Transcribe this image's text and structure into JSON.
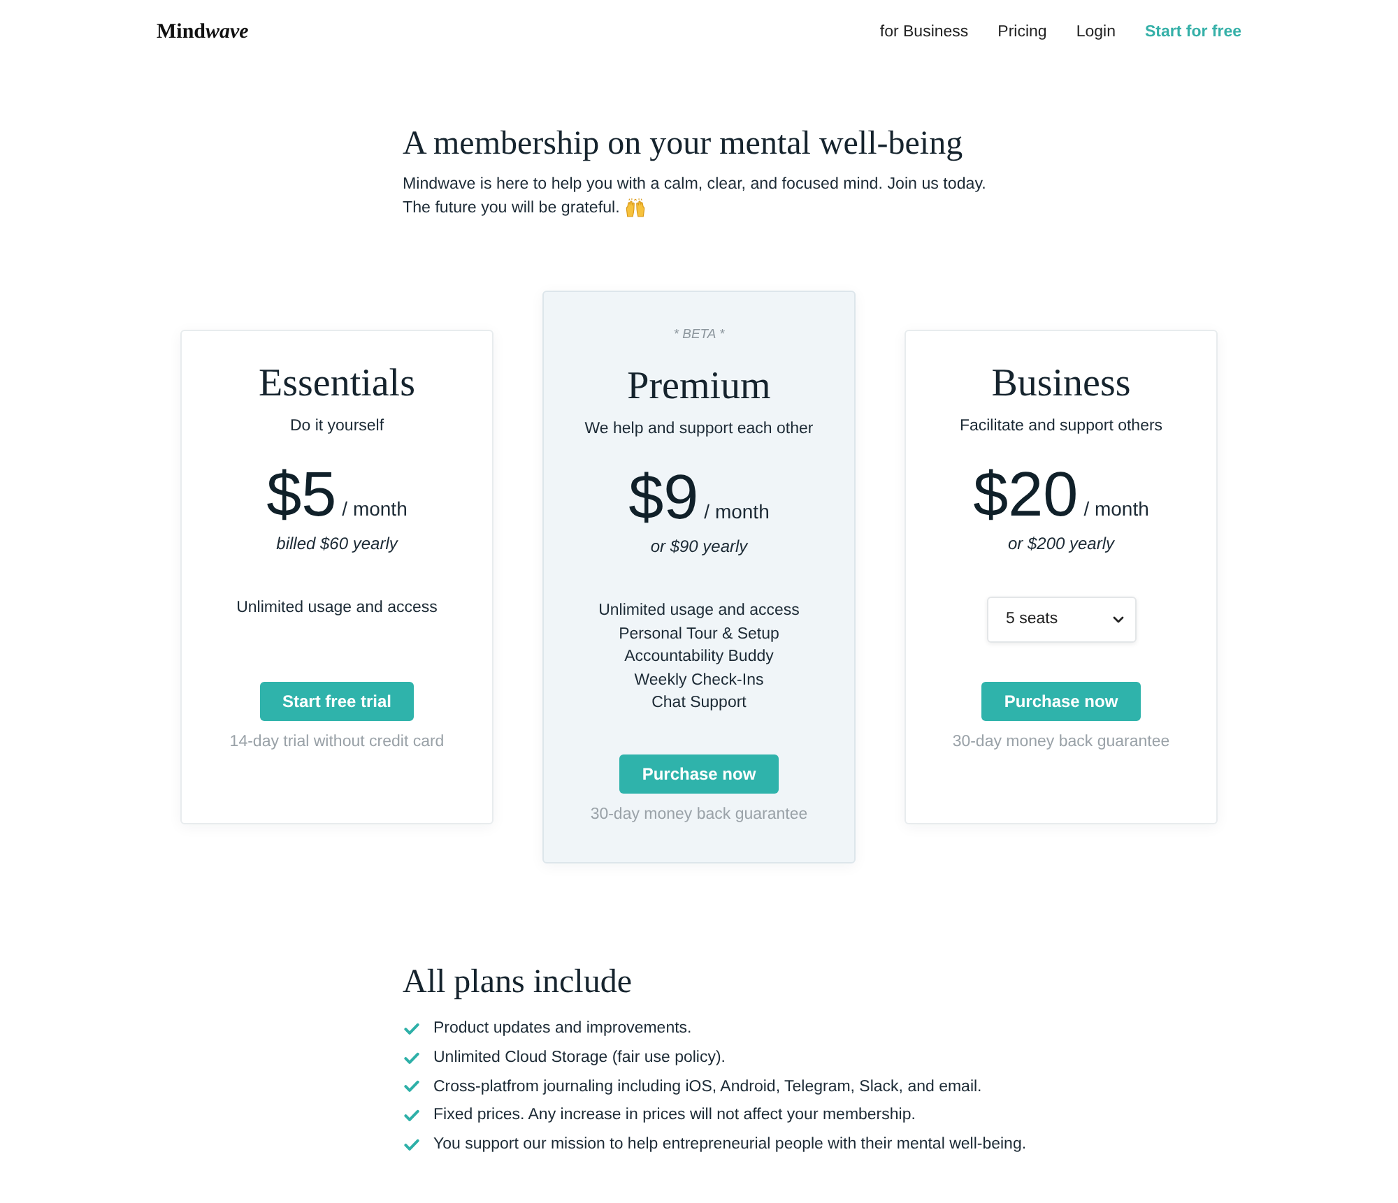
{
  "header": {
    "logo": [
      {
        "text": "Mind",
        "italic": false
      },
      {
        "text": "wave",
        "italic": true
      }
    ],
    "nav": [
      {
        "label": "for Business",
        "kind": "link"
      },
      {
        "label": "Pricing",
        "kind": "link"
      },
      {
        "label": "Login",
        "kind": "link"
      },
      {
        "label": "Start for free",
        "kind": "cta"
      }
    ]
  },
  "hero": {
    "title": "A membership on your mental well-being",
    "lines": [
      "Mindwave is here to help you with a calm, clear, and focused mind. Join us today.",
      "The future you will be grateful."
    ]
  },
  "plans": [
    {
      "name": "Essentials",
      "tagline": "Do it yourself",
      "highlighted": false,
      "price": "$5",
      "period": "/ month",
      "billing": "billed $60 yearly",
      "features": [
        "Unlimited usage and access"
      ],
      "button": "Start free trial",
      "note": "14-day trial without credit card"
    },
    {
      "badge": "* BETA *",
      "name": "Premium",
      "tagline": "We help and support each other",
      "highlighted": true,
      "price": "$9",
      "period": "/ month",
      "billing": "or $90 yearly",
      "features": [
        "Unlimited usage and access",
        "Personal Tour & Setup",
        "Accountability Buddy",
        "Weekly Check-Ins",
        "Chat Support"
      ],
      "button": "Purchase now",
      "note": "30-day money back guarantee"
    },
    {
      "name": "Business",
      "tagline": "Facilitate and support others",
      "highlighted": false,
      "price": "$20",
      "period": "/ month",
      "billing": "or $200 yearly",
      "seats": "5 seats",
      "button": "Purchase now",
      "note": "30-day money back guarantee"
    }
  ],
  "includes": {
    "title": "All plans include",
    "items": [
      "Product updates and improvements.",
      "Unlimited Cloud Storage (fair use policy).",
      "Cross-platfrom journaling including iOS, Android, Telegram, Slack, and email.",
      "Fixed prices. Any increase in prices will not affect your membership.",
      "You support our mission to help entrepreneurial people with their mental well-being."
    ]
  }
}
